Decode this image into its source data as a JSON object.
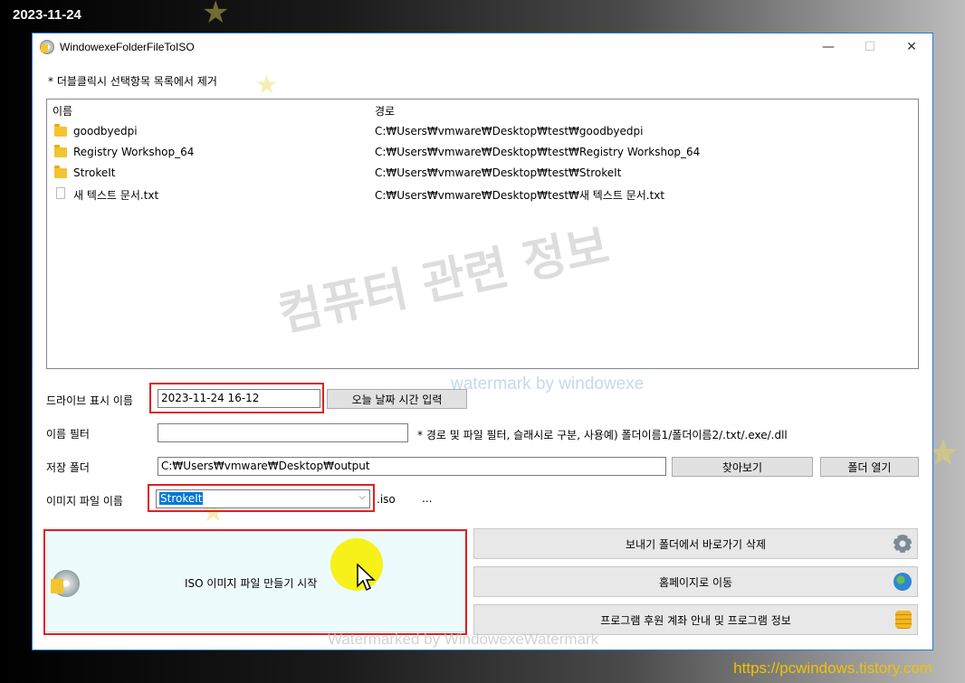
{
  "overlay": {
    "date": "2023-11-24",
    "site_url": "https://pcwindows.tistory.com"
  },
  "window": {
    "title": "WindowexeFolderFileToISO",
    "controls": {
      "minimize": "—",
      "maximize": "☐",
      "close": "✕"
    }
  },
  "hint_text": "* 더블클릭시 선택항목 목록에서 제거",
  "list": {
    "columns": [
      "이름",
      "경로"
    ],
    "rows": [
      {
        "icon": "folder-icon",
        "name": "goodbyedpi",
        "path": "C:₩Users₩vmware₩Desktop₩test₩goodbyedpi"
      },
      {
        "icon": "folder-icon",
        "name": "Registry Workshop_64",
        "path": "C:₩Users₩vmware₩Desktop₩test₩Registry Workshop_64"
      },
      {
        "icon": "folder-icon",
        "name": "StrokeIt",
        "path": "C:₩Users₩vmware₩Desktop₩test₩StrokeIt"
      },
      {
        "icon": "file-icon",
        "name": "새 텍스트 문서.txt",
        "path": "C:₩Users₩vmware₩Desktop₩test₩새 텍스트 문서.txt"
      }
    ]
  },
  "form": {
    "drive_label": "드라이브 표시 이름",
    "drive_value": "2023-11-24 16-12",
    "today_button": "오늘 날짜 시간 입력",
    "filter_label": "이름 필터",
    "filter_value": "",
    "filter_hint": "* 경로 및 파일 필터, 슬래시로 구분, 사용예) 폴더이름1/폴더이름2/.txt/.exe/.dll",
    "save_label": "저장 폴더",
    "save_value": "C:₩Users₩vmware₩Desktop₩output",
    "browse_button": "찾아보기",
    "open_folder_button": "폴더 열기",
    "image_label": "이미지 파일 이름",
    "image_value": "StrokeIt",
    "image_ext": ".iso",
    "image_more": "..."
  },
  "actions": {
    "start": "ISO 이미지 파일 만들기 시작",
    "delete_shortcut": "보내기 폴더에서 바로가기 삭제",
    "homepage": "홈페이지로 이동",
    "info": "프로그램 후원 계좌 안내 및 프로그램 정보"
  },
  "watermarks": {
    "korean": "컴퓨터 관련 정보",
    "english": "watermark by windowexe",
    "bottom": "Watermarked by WindowexeWatermark"
  },
  "colors": {
    "highlight_box": "#e02020",
    "selection": "#0078d7",
    "cursor_highlight": "#f5f000"
  }
}
